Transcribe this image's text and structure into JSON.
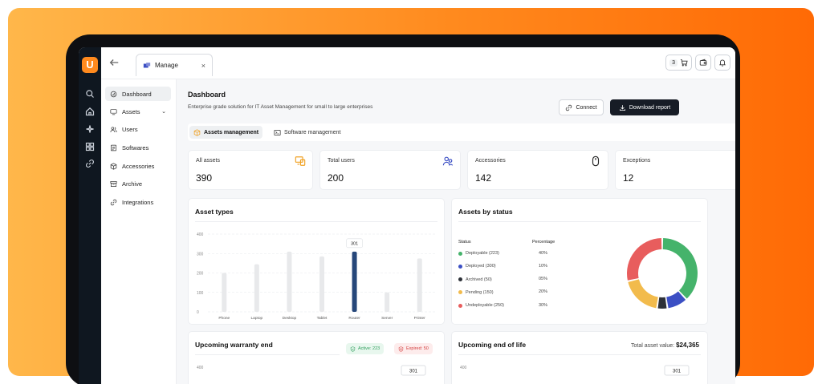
{
  "colors": {
    "accent": "#ff8a1e",
    "dark": "#171c26",
    "bar": "#e8e9eb",
    "bar_highlight": "#26477a"
  },
  "logo": {
    "letter": "U"
  },
  "rail": {
    "icons": [
      "search-icon",
      "home-icon",
      "sparkle-icon",
      "grid-icon",
      "link-icon"
    ]
  },
  "topbar": {
    "tab_label": "Manage",
    "tab_close": "×",
    "cart_count": "3"
  },
  "sidebar": {
    "items": [
      {
        "label": "Dashboard",
        "icon": "dashboard-icon",
        "active": true
      },
      {
        "label": "Assets",
        "icon": "monitor-icon",
        "chevron": "⌄"
      },
      {
        "label": "Users",
        "icon": "users-icon"
      },
      {
        "label": "Softwares",
        "icon": "software-icon"
      },
      {
        "label": "Accessories",
        "icon": "box-icon"
      },
      {
        "label": "Archive",
        "icon": "archive-icon"
      },
      {
        "label": "Integrations",
        "icon": "link-icon"
      }
    ]
  },
  "header": {
    "title": "Dashboard",
    "subtitle": "Enterprise grade solution for IT Asset Management for small to large enterprises",
    "connect_label": "Connect",
    "download_label": "Download report"
  },
  "subtabs": [
    {
      "label": "Assets management",
      "active": true
    },
    {
      "label": "Software management",
      "active": false
    }
  ],
  "stats": [
    {
      "label": "All assets",
      "value": "390",
      "icon": "devices-icon"
    },
    {
      "label": "Total users",
      "value": "200",
      "icon": "users-icon"
    },
    {
      "label": "Accessories",
      "value": "142",
      "icon": "mouse-icon"
    },
    {
      "label": "Exceptions",
      "value": "12",
      "icon": "alert-icon"
    }
  ],
  "asset_types": {
    "title": "Asset types",
    "chart_data": {
      "type": "bar",
      "categories": [
        "Phone",
        "Laptop",
        "Desktop",
        "Tablet",
        "Router",
        "Server",
        "Printer"
      ],
      "values": [
        200,
        245,
        310,
        285,
        310,
        100,
        275
      ],
      "highlight_index": 4,
      "highlight_label": "301",
      "yticks": [
        0,
        100,
        200,
        300,
        400
      ],
      "ylim": [
        0,
        400
      ]
    }
  },
  "assets_by_status": {
    "title": "Assets by status",
    "status_header": "Status",
    "percent_header": "Percentage",
    "chart_data": {
      "type": "pie",
      "labels": [
        "Deployable (223)",
        "Deployed (300)",
        "Archived (50)",
        "Pending (150)",
        "Undeployable (250)"
      ],
      "percent_labels": [
        "40%",
        "10%",
        "05%",
        "20%",
        "30%"
      ],
      "values": [
        40,
        10,
        5,
        20,
        30
      ],
      "colors": [
        "#45b36b",
        "#3b4fc4",
        "#2d3138",
        "#f2bb4c",
        "#e85d5d"
      ]
    }
  },
  "warranty": {
    "title": "Upcoming warranty end",
    "active_label": "Active: 223",
    "expired_label": "Expired: 50",
    "partial_chart": {
      "ytick": "400",
      "badge": "301"
    }
  },
  "end_of_life": {
    "title": "Upcoming end of life",
    "total_label": "Total asset value:",
    "total_value": "$24,365",
    "partial_chart": {
      "ytick": "400",
      "badge": "301"
    }
  }
}
